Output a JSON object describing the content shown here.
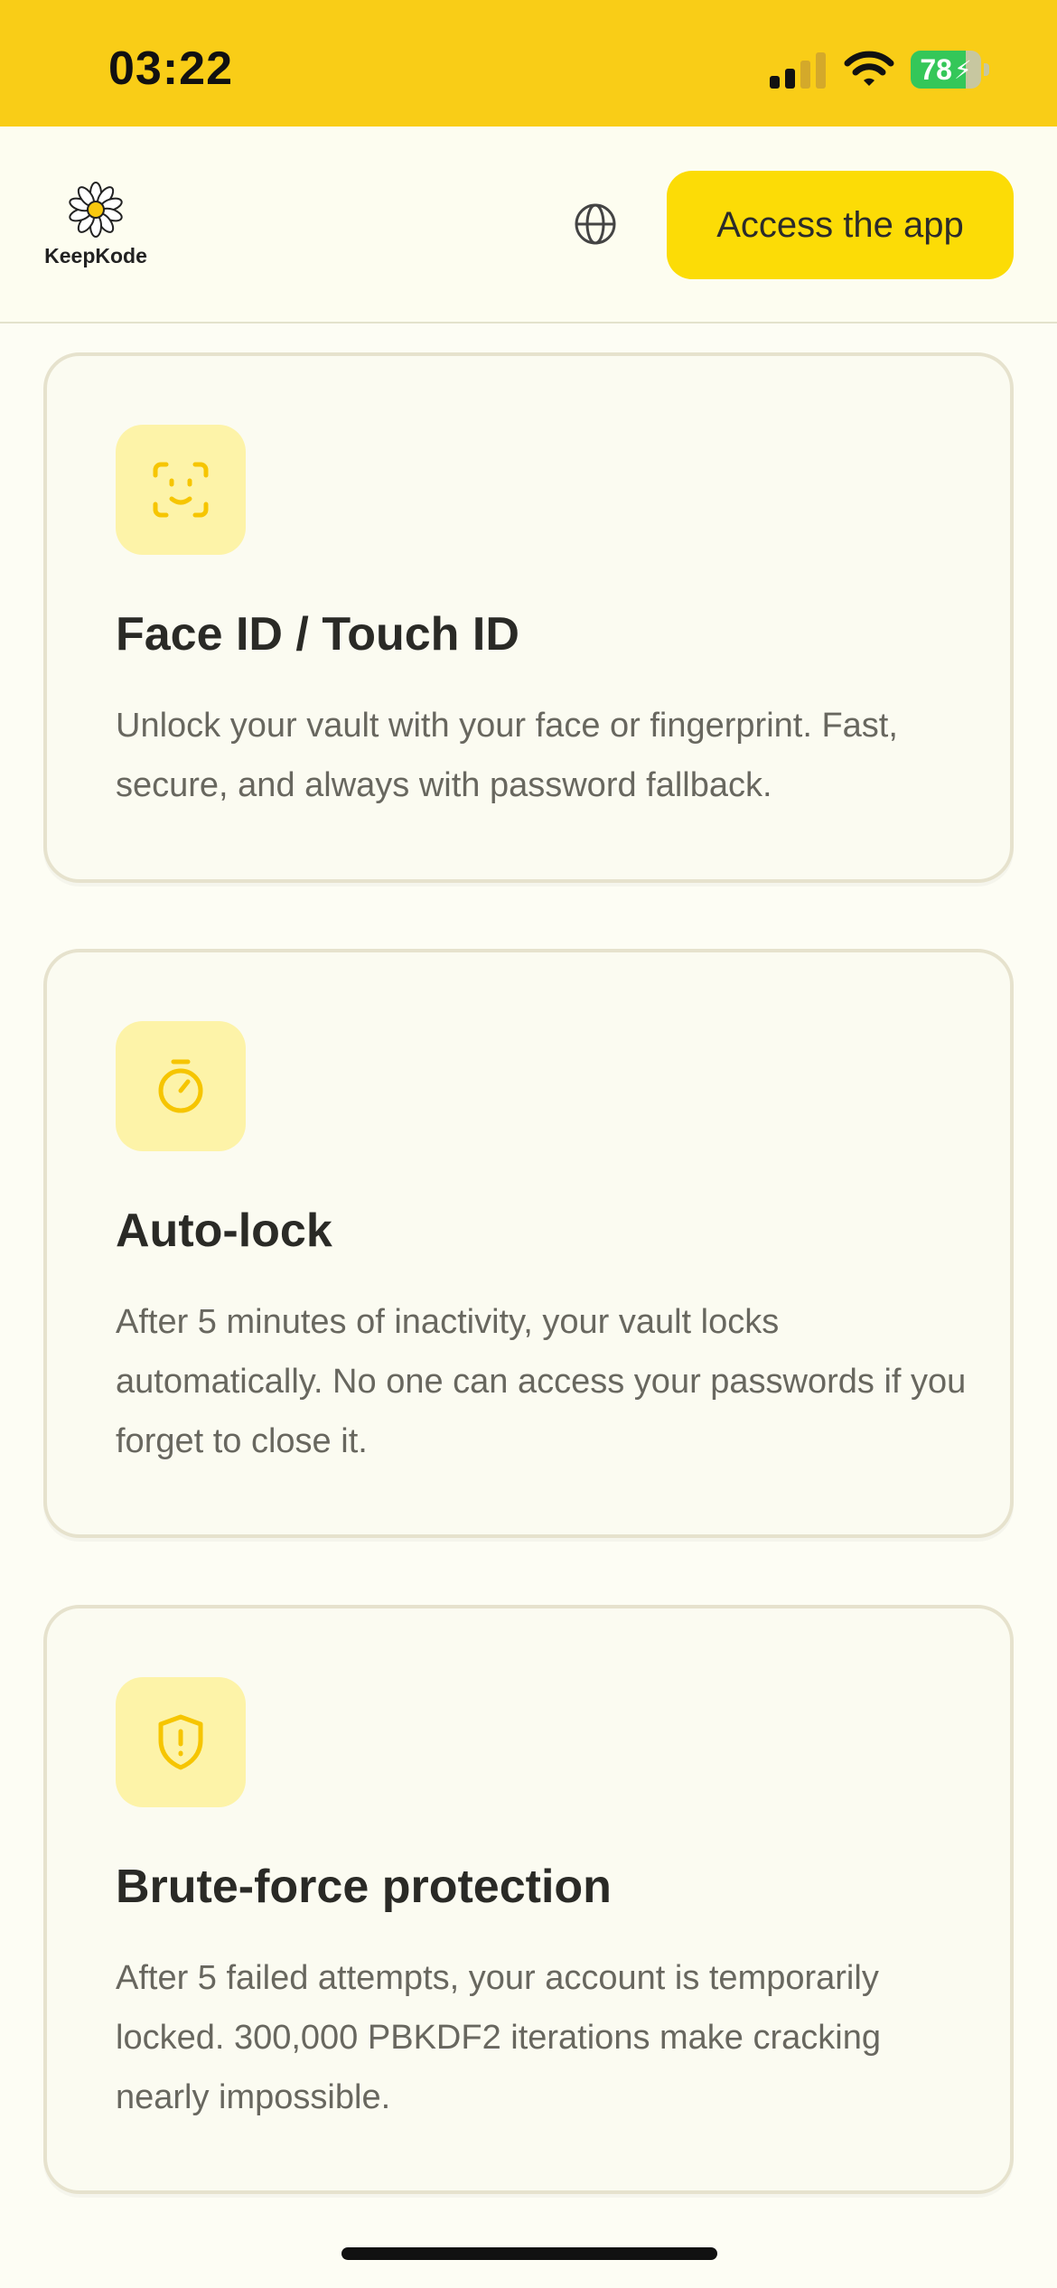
{
  "status_bar": {
    "time": "03:22",
    "battery": "78",
    "battery_level": 0.78,
    "background": "#f9cd17"
  },
  "header": {
    "logo_text": "KeepKode",
    "logo_icon": "daisy-flower-icon",
    "language_icon": "globe-icon",
    "cta_label": "Access the app",
    "accent": "#fcdc06"
  },
  "features": [
    {
      "icon": "face-id-icon",
      "title": "Face ID / Touch ID",
      "description": "Unlock your vault with your face or fingerprint. Fast, secure, and always with password fallback."
    },
    {
      "icon": "stopwatch-icon",
      "title": "Auto-lock",
      "description": "After 5 minutes of inactivity, your vault locks automatically. No one can access your passwords if you forget to close it."
    },
    {
      "icon": "shield-alert-icon",
      "title": "Brute-force protection",
      "description": "After 5 failed attempts, your account is temporarily locked. 300,000 PBKDF2 iterations make cracking nearly impossible."
    }
  ]
}
